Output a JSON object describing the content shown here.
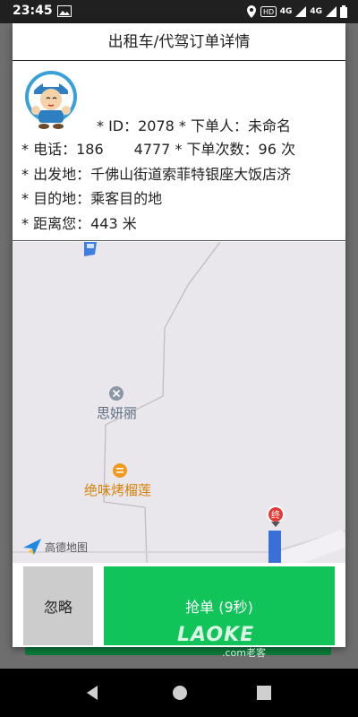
{
  "status_bar": {
    "time": "23:45",
    "net1": "4G",
    "net2": "4G"
  },
  "dialog": {
    "title": "出租车/代驾订单详情",
    "order": {
      "id_line": "* ID：2078 * 下单人：未命名",
      "phone_prefix": "* 电话：186",
      "phone_suffix": "4777 * 下单次数：96 次",
      "departure": "* 出发地：千佛山街道索菲特银座大饭店济",
      "destination": "* 目的地：乘客目的地",
      "distance": "* 距离您：443 米"
    },
    "map": {
      "poi1": "思妍丽",
      "poi2": "绝味烤榴莲",
      "provider": "高德地图",
      "end_marker": "终"
    },
    "buttons": {
      "ignore": "忽略",
      "grab": "抢单 (9秒)"
    }
  },
  "watermark": {
    "brand": "LAOKE",
    "sub": ".com老客"
  },
  "colors": {
    "grab_button": "#10c45a",
    "ignore_button": "#cccccc",
    "map_background": "#eae7ec"
  }
}
